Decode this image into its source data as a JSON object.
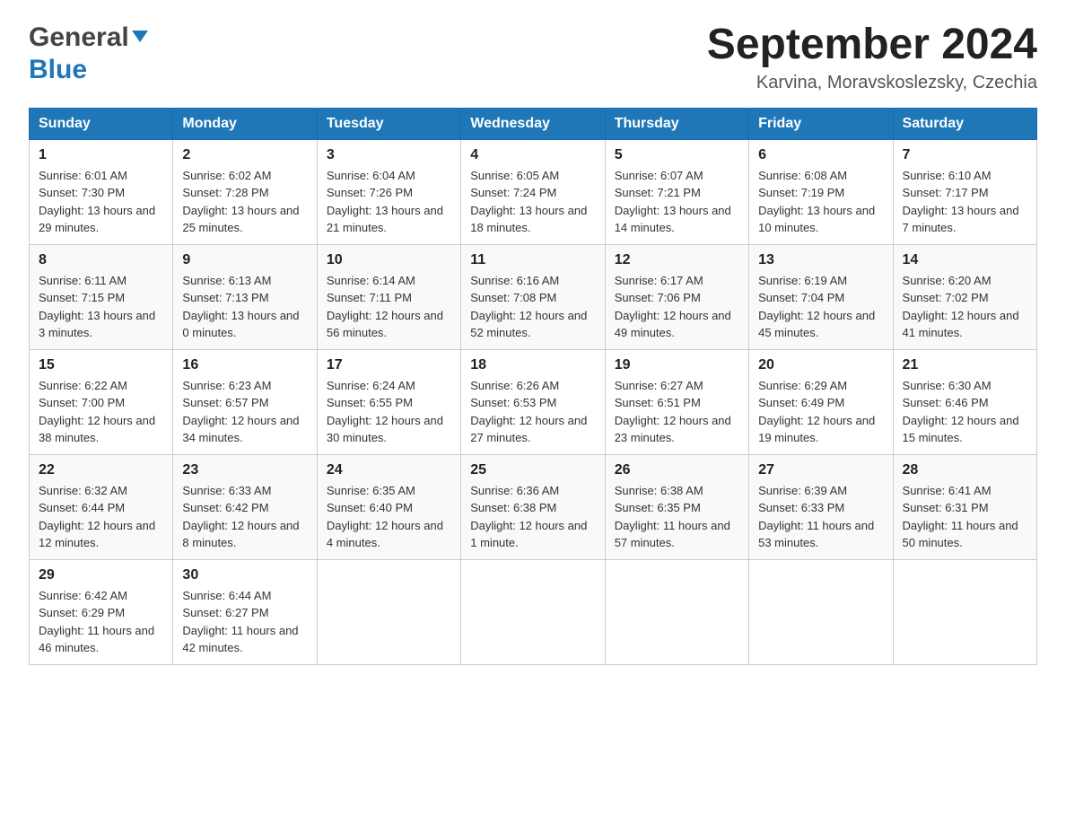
{
  "header": {
    "logo_general": "General",
    "logo_blue": "Blue",
    "title": "September 2024",
    "subtitle": "Karvina, Moravskoslezsky, Czechia"
  },
  "columns": [
    "Sunday",
    "Monday",
    "Tuesday",
    "Wednesday",
    "Thursday",
    "Friday",
    "Saturday"
  ],
  "weeks": [
    [
      {
        "day": "1",
        "sunrise": "6:01 AM",
        "sunset": "7:30 PM",
        "daylight": "13 hours and 29 minutes."
      },
      {
        "day": "2",
        "sunrise": "6:02 AM",
        "sunset": "7:28 PM",
        "daylight": "13 hours and 25 minutes."
      },
      {
        "day": "3",
        "sunrise": "6:04 AM",
        "sunset": "7:26 PM",
        "daylight": "13 hours and 21 minutes."
      },
      {
        "day": "4",
        "sunrise": "6:05 AM",
        "sunset": "7:24 PM",
        "daylight": "13 hours and 18 minutes."
      },
      {
        "day": "5",
        "sunrise": "6:07 AM",
        "sunset": "7:21 PM",
        "daylight": "13 hours and 14 minutes."
      },
      {
        "day": "6",
        "sunrise": "6:08 AM",
        "sunset": "7:19 PM",
        "daylight": "13 hours and 10 minutes."
      },
      {
        "day": "7",
        "sunrise": "6:10 AM",
        "sunset": "7:17 PM",
        "daylight": "13 hours and 7 minutes."
      }
    ],
    [
      {
        "day": "8",
        "sunrise": "6:11 AM",
        "sunset": "7:15 PM",
        "daylight": "13 hours and 3 minutes."
      },
      {
        "day": "9",
        "sunrise": "6:13 AM",
        "sunset": "7:13 PM",
        "daylight": "13 hours and 0 minutes."
      },
      {
        "day": "10",
        "sunrise": "6:14 AM",
        "sunset": "7:11 PM",
        "daylight": "12 hours and 56 minutes."
      },
      {
        "day": "11",
        "sunrise": "6:16 AM",
        "sunset": "7:08 PM",
        "daylight": "12 hours and 52 minutes."
      },
      {
        "day": "12",
        "sunrise": "6:17 AM",
        "sunset": "7:06 PM",
        "daylight": "12 hours and 49 minutes."
      },
      {
        "day": "13",
        "sunrise": "6:19 AM",
        "sunset": "7:04 PM",
        "daylight": "12 hours and 45 minutes."
      },
      {
        "day": "14",
        "sunrise": "6:20 AM",
        "sunset": "7:02 PM",
        "daylight": "12 hours and 41 minutes."
      }
    ],
    [
      {
        "day": "15",
        "sunrise": "6:22 AM",
        "sunset": "7:00 PM",
        "daylight": "12 hours and 38 minutes."
      },
      {
        "day": "16",
        "sunrise": "6:23 AM",
        "sunset": "6:57 PM",
        "daylight": "12 hours and 34 minutes."
      },
      {
        "day": "17",
        "sunrise": "6:24 AM",
        "sunset": "6:55 PM",
        "daylight": "12 hours and 30 minutes."
      },
      {
        "day": "18",
        "sunrise": "6:26 AM",
        "sunset": "6:53 PM",
        "daylight": "12 hours and 27 minutes."
      },
      {
        "day": "19",
        "sunrise": "6:27 AM",
        "sunset": "6:51 PM",
        "daylight": "12 hours and 23 minutes."
      },
      {
        "day": "20",
        "sunrise": "6:29 AM",
        "sunset": "6:49 PM",
        "daylight": "12 hours and 19 minutes."
      },
      {
        "day": "21",
        "sunrise": "6:30 AM",
        "sunset": "6:46 PM",
        "daylight": "12 hours and 15 minutes."
      }
    ],
    [
      {
        "day": "22",
        "sunrise": "6:32 AM",
        "sunset": "6:44 PM",
        "daylight": "12 hours and 12 minutes."
      },
      {
        "day": "23",
        "sunrise": "6:33 AM",
        "sunset": "6:42 PM",
        "daylight": "12 hours and 8 minutes."
      },
      {
        "day": "24",
        "sunrise": "6:35 AM",
        "sunset": "6:40 PM",
        "daylight": "12 hours and 4 minutes."
      },
      {
        "day": "25",
        "sunrise": "6:36 AM",
        "sunset": "6:38 PM",
        "daylight": "12 hours and 1 minute."
      },
      {
        "day": "26",
        "sunrise": "6:38 AM",
        "sunset": "6:35 PM",
        "daylight": "11 hours and 57 minutes."
      },
      {
        "day": "27",
        "sunrise": "6:39 AM",
        "sunset": "6:33 PM",
        "daylight": "11 hours and 53 minutes."
      },
      {
        "day": "28",
        "sunrise": "6:41 AM",
        "sunset": "6:31 PM",
        "daylight": "11 hours and 50 minutes."
      }
    ],
    [
      {
        "day": "29",
        "sunrise": "6:42 AM",
        "sunset": "6:29 PM",
        "daylight": "11 hours and 46 minutes."
      },
      {
        "day": "30",
        "sunrise": "6:44 AM",
        "sunset": "6:27 PM",
        "daylight": "11 hours and 42 minutes."
      },
      null,
      null,
      null,
      null,
      null
    ]
  ]
}
